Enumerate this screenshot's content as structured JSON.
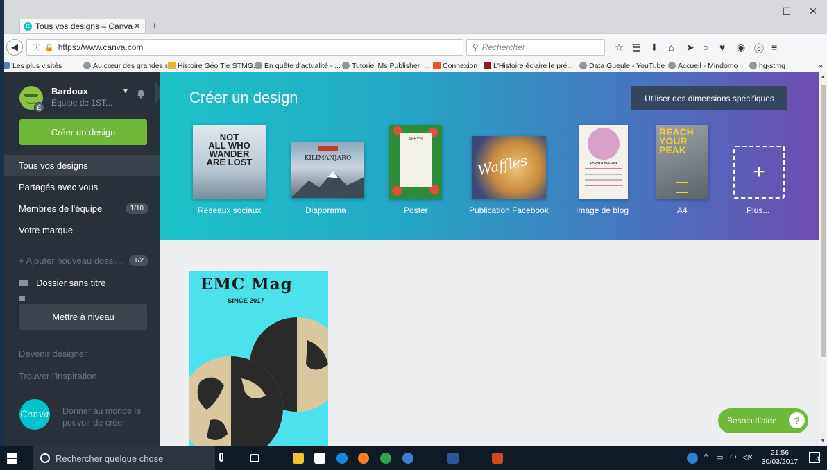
{
  "browser": {
    "tab_title": "Tous vos designs – Canva",
    "tab_close": "✕",
    "new_tab": "+",
    "url": "https://www.canva.com",
    "search_placeholder": "Rechercher",
    "window_controls": {
      "minimize": "–",
      "maximize": "☐",
      "close": "✕"
    },
    "bookmarks": [
      "Les plus visités",
      "Au cœur des grandes r...",
      "Histoire Géo Tle STMG...",
      "En quête d'actualité - ...",
      "Tutoriel Ms Publisher |...",
      "Connexion",
      "L'Histoire éclaire le pré...",
      "Data Gueule - YouTube",
      "Accueil - Mindomo",
      "hg-stmg"
    ],
    "bookmarks_overflow": "»"
  },
  "sidebar": {
    "username": "Bardoux",
    "team": "Équipe de 1ST...",
    "avatar_badge": "É",
    "create_button": "Créer un design",
    "nav": [
      {
        "label": "Tous vos designs",
        "active": true
      },
      {
        "label": "Partagés avec vous"
      },
      {
        "label": "Membres de l'équipe",
        "badge": "1/10"
      },
      {
        "label": "Votre marque"
      }
    ],
    "add_folder": "+ Ajouter nouveau dossi...",
    "add_folder_badge": "1/2",
    "folder": "Dossier sans titre",
    "upgrade_button": "Mettre à niveau",
    "become_designer": "Devenir designer",
    "inspiration": "Trouver l'inspiration",
    "logo_text": "Canva",
    "slogan": "Donner au monde le pouvoir de créer"
  },
  "hero": {
    "title": "Créer un design",
    "custom_dimensions": "Utiliser des dimensions spécifiques",
    "templates": [
      {
        "label": "Réseaux sociaux",
        "thumb_text": [
          "NOT",
          "ALL WHO",
          "WANDER",
          "ARE LOST"
        ]
      },
      {
        "label": "Diaporama",
        "thumb_text": [
          "KILIMANJARO"
        ]
      },
      {
        "label": "Poster",
        "thumb_text": [
          "ABEY'S"
        ]
      },
      {
        "label": "Publication Facebook",
        "thumb_text": [
          "Waffles"
        ]
      },
      {
        "label": "Image de blog",
        "thumb_text": [
          "LAURYN HOLDEN"
        ]
      },
      {
        "label": "A4",
        "thumb_text": [
          "REACH",
          "YOUR",
          "PEAK"
        ]
      },
      {
        "label": "Plus..."
      }
    ]
  },
  "design": {
    "title": "EMC Mag",
    "subtitle": "SINCE 2017"
  },
  "help_button": "Besoin d'aide",
  "help_icon": "?",
  "taskbar": {
    "search": "Rechercher quelque chose",
    "time": "21:56",
    "date": "30/03/2017",
    "notifications": "4"
  },
  "colors": {
    "sidebar_bg": "#293039",
    "accent_green": "#6eb83a",
    "canva_teal": "#00c4cc",
    "custom_button_bg": "#364560"
  }
}
